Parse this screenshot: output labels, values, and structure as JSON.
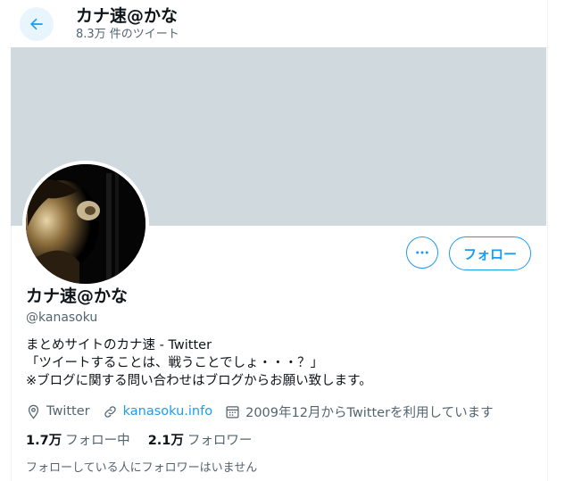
{
  "header": {
    "title": "カナ速@かな",
    "tweet_count": "8.3万 件のツイート"
  },
  "profile": {
    "name": "カナ速@かな",
    "handle": "@kanasoku",
    "bio_lines": [
      "まとめサイトのカナ速 - Twitter",
      "「ツイートすることは、戦うことでしょ・・・？」",
      "※ブログに関する問い合わせはブログからお願い致します。"
    ],
    "location": "Twitter",
    "url": "kanasoku.info",
    "joined": "2009年12月からTwitterを利用しています",
    "following_count": "1.7万",
    "following_label": "フォロー中",
    "followers_count": "2.1万",
    "followers_label": "フォロワー",
    "no_mutual_followers": "フォローしている人にフォロワーはいません"
  },
  "actions": {
    "follow_label": "フォロー"
  },
  "colors": {
    "accent": "#1d9bf0",
    "banner": "#cfd9de",
    "secondary_text": "#536471"
  },
  "icons": [
    "back-arrow-icon",
    "more-icon",
    "location-icon",
    "link-icon",
    "calendar-icon"
  ]
}
